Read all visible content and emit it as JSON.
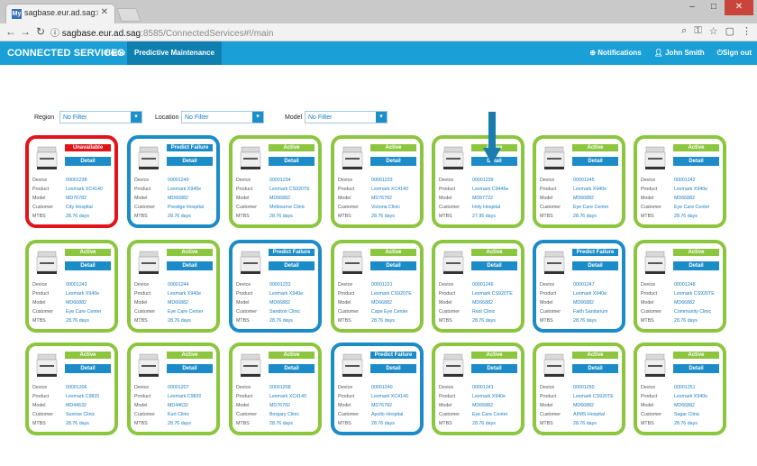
{
  "browser": {
    "tab_title": "sagbase.eur.ad.sag:8585",
    "tab_favicon": "My",
    "url_host": "sagbase.eur.ad.sag",
    "url_path": ":8585/ConnectedServices#!/main"
  },
  "header": {
    "brand": "CONNECTED SERVICES",
    "nav_home": "Home",
    "nav_active": "Predictive Maintenance",
    "notifications": "Notifications",
    "user": "John Smith",
    "signout": "Sign out"
  },
  "filters": {
    "region_label": "Region",
    "region_value": "No Filter",
    "location_label": "Location",
    "location_value": "No Filter",
    "model_label": "Model",
    "model_value": "No Filter"
  },
  "field_labels": {
    "device": "Device",
    "product": "Product",
    "model": "Model",
    "customer": "Customer",
    "mtbs": "MTBS"
  },
  "detail_label": "Detail",
  "devices": [
    {
      "status": "Unavailable",
      "device": "00001238",
      "product": "Lexmark XC4140",
      "model": "MD76782",
      "customer": "City Hospital",
      "mtbs": "28.76 days"
    },
    {
      "status": "Predict Failure",
      "device": "00001249",
      "product": "Lexmark X940e",
      "model": "MD66882",
      "customer": "Prestige Hospital",
      "mtbs": "28.76 days"
    },
    {
      "status": "Active",
      "device": "00001234",
      "product": "Lexmark CS920TE",
      "model": "MD66882",
      "customer": "Melbourne Clinic",
      "mtbs": "28.76 days"
    },
    {
      "status": "Active",
      "device": "00001233",
      "product": "Lexmark XC4140",
      "model": "MD76782",
      "customer": "Victoria Clinic",
      "mtbs": "28.76 days"
    },
    {
      "status": "Active",
      "device": "00001239",
      "product": "Lexmark C9446e",
      "model": "MD67722",
      "customer": "Holy Hospital",
      "mtbs": "27.95 days"
    },
    {
      "status": "Active",
      "device": "00001245",
      "product": "Lexmark X940e",
      "model": "MD66882",
      "customer": "Eye Care Center",
      "mtbs": "28.76 days"
    },
    {
      "status": "Active",
      "device": "00001242",
      "product": "Lexmark X940e",
      "model": "MD66882",
      "customer": "Eye Care Center",
      "mtbs": "28.76 days"
    },
    {
      "status": "Active",
      "device": "00001243",
      "product": "Lexmark X940e",
      "model": "MD66882",
      "customer": "Eye Care Center",
      "mtbs": "28.76 days"
    },
    {
      "status": "Active",
      "device": "00001244",
      "product": "Lexmark X940e",
      "model": "MD66882",
      "customer": "Eye Care Center",
      "mtbs": "28.76 days"
    },
    {
      "status": "Predict Failure",
      "device": "00001232",
      "product": "Lexmark X940e",
      "model": "MD66882",
      "customer": "Sandton Clinic",
      "mtbs": "28.76 days"
    },
    {
      "status": "Active",
      "device": "00001221",
      "product": "Lexmark CS920TE",
      "model": "MD66882",
      "customer": "Cape Eye Center",
      "mtbs": "28.76 days"
    },
    {
      "status": "Active",
      "device": "00001246",
      "product": "Lexmark CS920TE",
      "model": "MD66882",
      "customer": "Rest Clinic",
      "mtbs": "28.76 days"
    },
    {
      "status": "Predict Failure",
      "device": "00001247",
      "product": "Lexmark X940e",
      "model": "MD66882",
      "customer": "Faith Sanitarium",
      "mtbs": "28.76 days"
    },
    {
      "status": "Active",
      "device": "00001248",
      "product": "Lexmark CS920TE",
      "model": "MD66882",
      "customer": "Community Clinic",
      "mtbs": "28.76 days"
    },
    {
      "status": "Active",
      "device": "00001206",
      "product": "Lexmark C9820",
      "model": "MD44632",
      "customer": "Sunrise Clinic",
      "mtbs": "28.76 days"
    },
    {
      "status": "Active",
      "device": "00001207",
      "product": "Lexmark C9820",
      "model": "MD44632",
      "customer": "Kurt Clinic",
      "mtbs": "28.76 days"
    },
    {
      "status": "Active",
      "device": "00001208",
      "product": "Lexmark XC4140",
      "model": "MD76782",
      "customer": "Borgary Clinic",
      "mtbs": "28.76 days"
    },
    {
      "status": "Predict Failure",
      "device": "00001240",
      "product": "Lexmark XC4140",
      "model": "MD76782",
      "customer": "Apollo Hospital",
      "mtbs": "28.76 days"
    },
    {
      "status": "Active",
      "device": "00001241",
      "product": "Lexmark X940e",
      "model": "MD66882",
      "customer": "Eye Care Center",
      "mtbs": "28.76 days"
    },
    {
      "status": "Active",
      "device": "00001250",
      "product": "Lexmark CS920TE",
      "model": "MD66882",
      "customer": "AIIMS Hospital",
      "mtbs": "28.76 days"
    },
    {
      "status": "Active",
      "device": "00001251",
      "product": "Lexmark X940e",
      "model": "MD66882",
      "customer": "Sagar Clinic",
      "mtbs": "28.76 days"
    }
  ],
  "colors": {
    "active": "#8cc63f",
    "unavailable": "#e1141a",
    "predict": "#1c8cc8",
    "header": "#1aa0d6"
  }
}
